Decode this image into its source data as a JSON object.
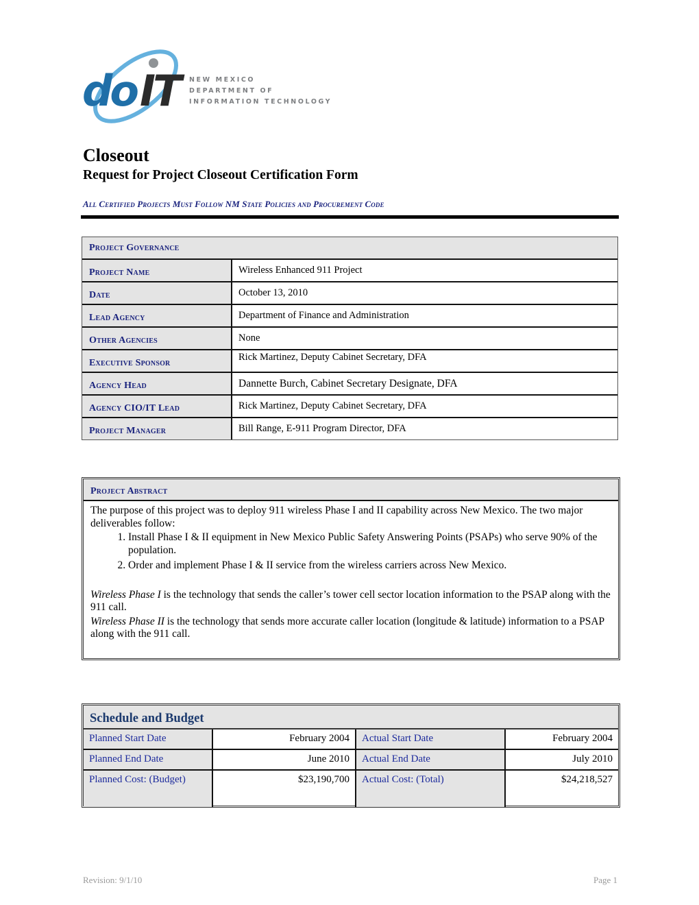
{
  "logo": {
    "wordmark": "doIT",
    "org_lines": [
      "NEW MEXICO",
      "DEPARTMENT OF",
      "INFORMATION TECHNOLOGY"
    ],
    "colors": {
      "blue": "#1f6fa8",
      "dark": "#2b2b2b",
      "swoosh": "#4aa3d8"
    }
  },
  "header": {
    "title": "Closeout",
    "subtitle": "Request for Project Closeout Certification Form",
    "policy": "All Certified Projects Must Follow NM State Policies and Procurement Code"
  },
  "governance": {
    "heading": "Project Governance",
    "rows": [
      {
        "label": "Project Name",
        "value": "Wireless Enhanced 911 Project"
      },
      {
        "label": "Date",
        "value": "October 13, 2010"
      },
      {
        "label": "Lead Agency",
        "value": "Department of Finance and Administration"
      },
      {
        "label": "Other Agencies",
        "value": "None"
      },
      {
        "label": "Executive Sponsor",
        "value": "Rick Martinez, Deputy Cabinet Secretary, DFA"
      },
      {
        "label": "Agency Head",
        "value": "Dannette Burch, Cabinet Secretary Designate, DFA"
      },
      {
        "label": "Agency CIO/IT Lead",
        "value": "Rick Martinez, Deputy Cabinet Secretary, DFA"
      },
      {
        "label": "Project Manager",
        "value": "Bill Range, E-911 Program Director, DFA"
      }
    ]
  },
  "abstract": {
    "heading": "Project Abstract",
    "intro": "The purpose of this project was to deploy 911 wireless Phase I and II capability across New Mexico. The two major deliverables follow:",
    "deliverables": [
      "Install Phase I & II equipment in New Mexico Public Safety Answering Points (PSAPs) who serve 90% of the population.",
      "Order and implement Phase I & II service from the wireless carriers across New Mexico."
    ],
    "phase1_term": "Wireless Phase I",
    "phase1_text": " is the technology that sends the caller’s tower cell sector location information to the PSAP along with the 911 call.",
    "phase2_term": "Wireless Phase II",
    "phase2_text": " is the technology that sends more accurate caller location (longitude & latitude) information to a PSAP along with the 911 call."
  },
  "schedule": {
    "heading": "Schedule and Budget",
    "rows": [
      {
        "planned_label": "Planned Start Date",
        "planned_value": "February 2004",
        "actual_label": "Actual Start Date",
        "actual_value": "February 2004"
      },
      {
        "planned_label": "Planned End Date",
        "planned_value": "June 2010",
        "actual_label": "Actual End Date",
        "actual_value": "July 2010"
      },
      {
        "planned_label": "Planned Cost: (Budget)",
        "planned_value": "$23,190,700",
        "actual_label": "Actual Cost: (Total)",
        "actual_value": "$24,218,527"
      }
    ]
  },
  "footer": {
    "revision": "Revision: 9/1/10",
    "page": "Page 1"
  }
}
